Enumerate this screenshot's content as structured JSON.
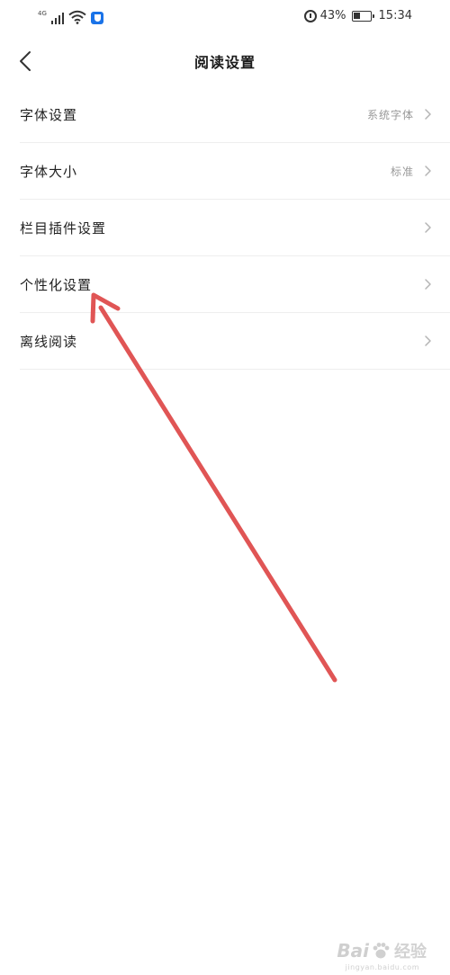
{
  "status_bar": {
    "network": "4G",
    "battery": "43%",
    "battery_level": 0.43,
    "time": "15:34"
  },
  "header": {
    "title": "阅读设置"
  },
  "settings": [
    {
      "label": "字体设置",
      "value": "系统字体"
    },
    {
      "label": "字体大小",
      "value": "标准"
    },
    {
      "label": "栏目插件设置",
      "value": ""
    },
    {
      "label": "个性化设置",
      "value": ""
    },
    {
      "label": "离线阅读",
      "value": ""
    }
  ],
  "annotation": {
    "color": "#e05555"
  },
  "watermark": {
    "brand": "Bai",
    "suffix": "经验",
    "url": "jingyan.baidu.com"
  }
}
